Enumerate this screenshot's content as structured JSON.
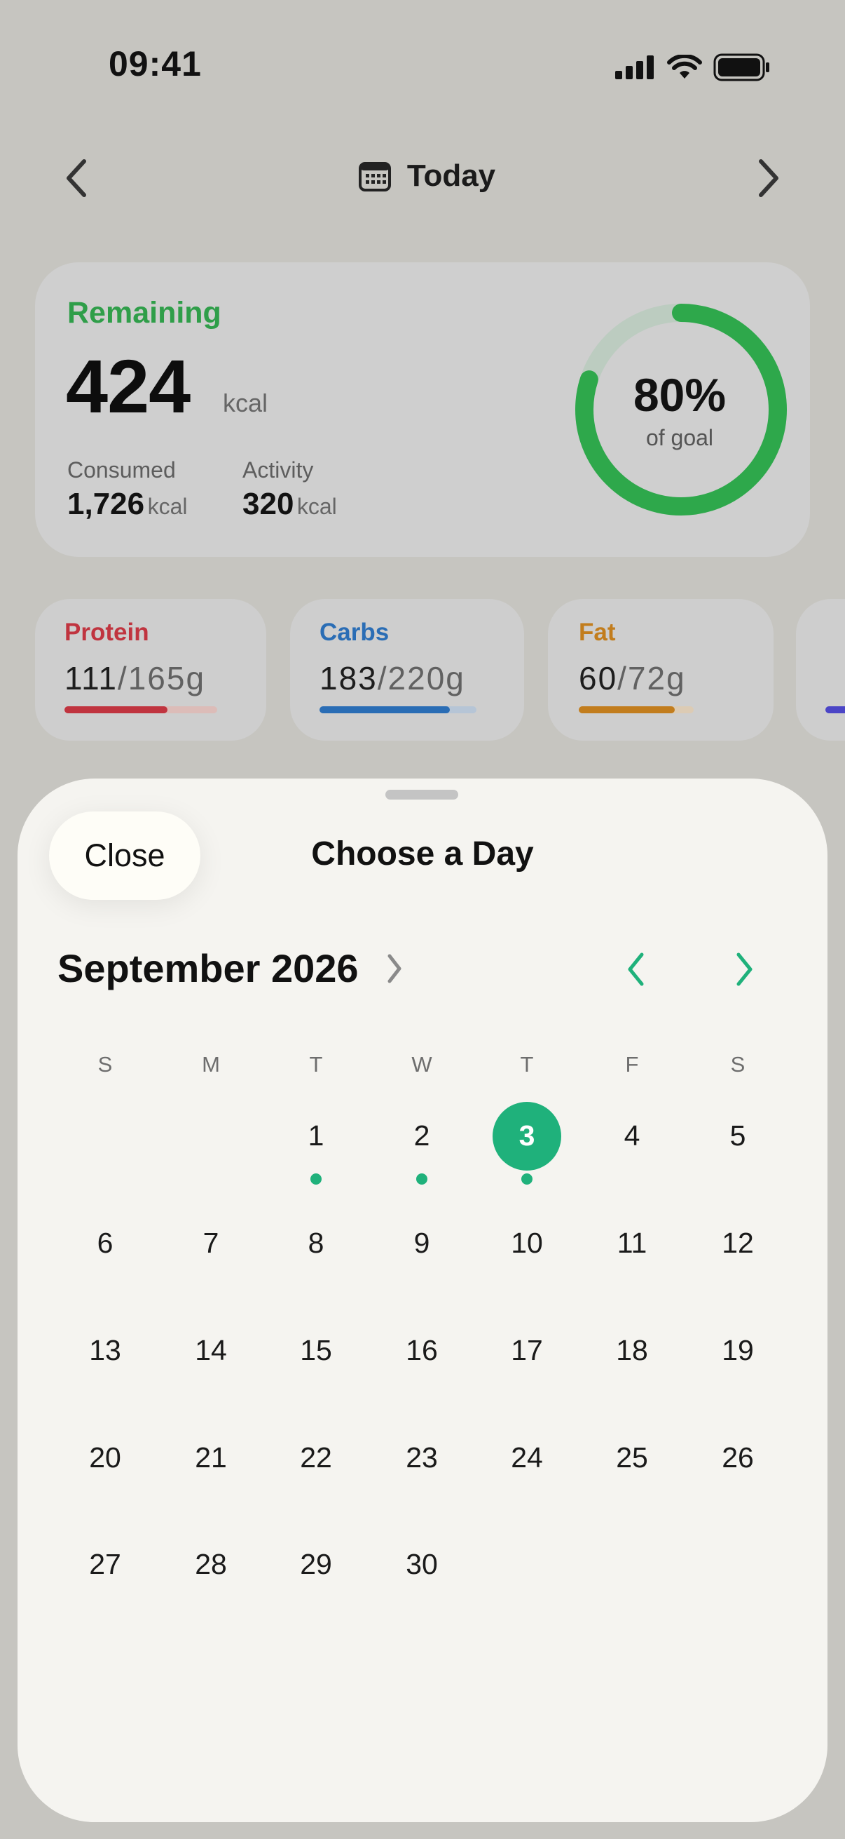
{
  "status_bar": {
    "time": "09:41"
  },
  "nav": {
    "prev_icon": "chevron-left-icon",
    "next_icon": "chevron-right-icon",
    "date_label": "Today",
    "calendar_icon": "calendar-icon"
  },
  "summary": {
    "remaining_label": "Remaining",
    "remaining_value": "424",
    "remaining_unit": "kcal",
    "consumed_label": "Consumed",
    "consumed_value": "1,726",
    "consumed_unit": "kcal",
    "activity_label": "Activity",
    "activity_value": "320",
    "activity_unit": "kcal",
    "goal_percent_text": "80%",
    "goal_caption": "of goal",
    "goal_fraction": 0.8,
    "ring_color": "#2ea84b"
  },
  "macros": [
    {
      "name": "Protein",
      "value": "111",
      "goal": "/165",
      "unit": "g",
      "progress": 0.673,
      "color": "#c0343f",
      "track": "#dcbcb8"
    },
    {
      "name": "Carbs",
      "value": "183",
      "goal": "/220",
      "unit": "g",
      "progress": 0.832,
      "color": "#2a6db5",
      "track": "#b6c5d6"
    },
    {
      "name": "Fat",
      "value": "60",
      "goal": "/72",
      "unit": "g",
      "progress": 0.833,
      "color": "#c27d1d",
      "track": "#dccbb4"
    }
  ],
  "sheet": {
    "close_label": "Close",
    "title": "Choose a Day",
    "month_label": "September 2026",
    "weekdays": [
      "S",
      "M",
      "T",
      "W",
      "T",
      "F",
      "S"
    ],
    "selected_day": "3",
    "days_with_entries": [
      "1",
      "2",
      "3"
    ],
    "accent_color": "#1fb17b",
    "weeks": [
      [
        "",
        "",
        "1",
        "2",
        "3",
        "4",
        "5"
      ],
      [
        "6",
        "7",
        "8",
        "9",
        "10",
        "11",
        "12"
      ],
      [
        "13",
        "14",
        "15",
        "16",
        "17",
        "18",
        "19"
      ],
      [
        "20",
        "21",
        "22",
        "23",
        "24",
        "25",
        "26"
      ],
      [
        "27",
        "28",
        "29",
        "30",
        "",
        "",
        ""
      ]
    ]
  }
}
